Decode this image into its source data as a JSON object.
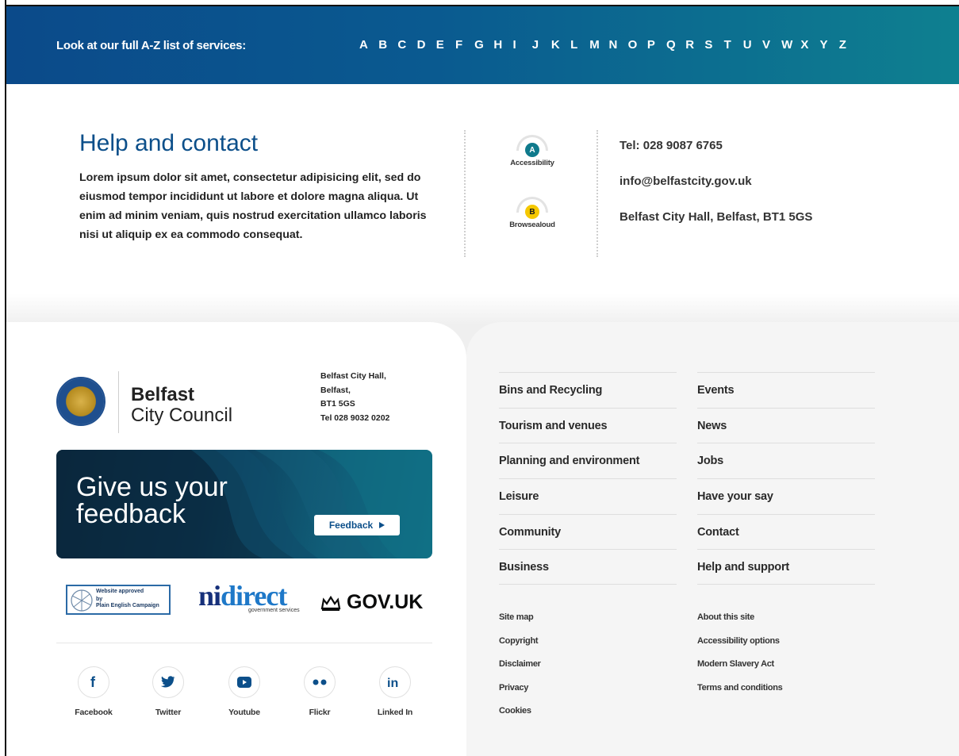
{
  "az": {
    "label": "Look at our full A-Z list of services:",
    "letters": [
      "A",
      "B",
      "C",
      "D",
      "E",
      "F",
      "G",
      "H",
      "I",
      "J",
      "K",
      "L",
      "M",
      "N",
      "O",
      "P",
      "Q",
      "R",
      "S",
      "T",
      "U",
      "V",
      "W",
      "X",
      "Y",
      "Z"
    ]
  },
  "help": {
    "title": "Help and contact",
    "text": "Lorem ipsum dolor sit amet, consectetur adipisicing elit, sed do eiusmod tempor incididunt ut labore et dolore magna aliqua. Ut enim ad minim veniam, quis nostrud exercitation ullamco laboris nisi ut aliquip ex ea commodo consequat."
  },
  "tools": [
    {
      "letter": "A",
      "label": "Accessibility"
    },
    {
      "letter": "B",
      "label": "Browsealoud"
    }
  ],
  "contact": {
    "tel": "Tel: 028 9087 6765",
    "email": "info@belfastcity.gov.uk",
    "address": "Belfast City Hall, Belfast, BT1 5GS"
  },
  "footer": {
    "logo": {
      "line1": "Belfast",
      "line2": "City Council"
    },
    "address": [
      "Belfast City Hall,",
      "Belfast,",
      "BT1 5GS",
      "Tel 028 9032 0202"
    ],
    "feedback": {
      "heading": "Give us your feedback",
      "button": "Feedback"
    },
    "partners": {
      "peb": [
        "Website approved",
        "by",
        "Plain English Campaign"
      ],
      "nidirect": {
        "ni": "ni",
        "direct": "direct",
        "sub": "government services"
      },
      "govuk": "GOV.UK"
    },
    "social": [
      {
        "glyph": "f",
        "label": "Facebook"
      },
      {
        "glyph": "t",
        "label": "Twitter"
      },
      {
        "glyph": "yt",
        "label": "Youtube"
      },
      {
        "glyph": "fl",
        "label": "Flickr"
      },
      {
        "glyph": "in",
        "label": "Linked In"
      }
    ],
    "links_col1": [
      "Bins and Recycling",
      "Tourism and venues",
      "Planning and environment",
      "Leisure",
      "Community",
      "Business"
    ],
    "links_col2": [
      "Events",
      "News",
      "Jobs",
      "Have your say",
      "Contact",
      "Help and support"
    ],
    "small_col1": [
      "Site map",
      "Copyright",
      "Disclaimer",
      "Privacy",
      "Cookies"
    ],
    "small_col2": [
      "About this site",
      "Accessibility options",
      "Modern Slavery Act",
      "Terms and conditions"
    ]
  },
  "colors": {
    "brand_blue": "#0c4f8a",
    "teal": "#0f7a8c",
    "yellow": "#f5c800"
  }
}
